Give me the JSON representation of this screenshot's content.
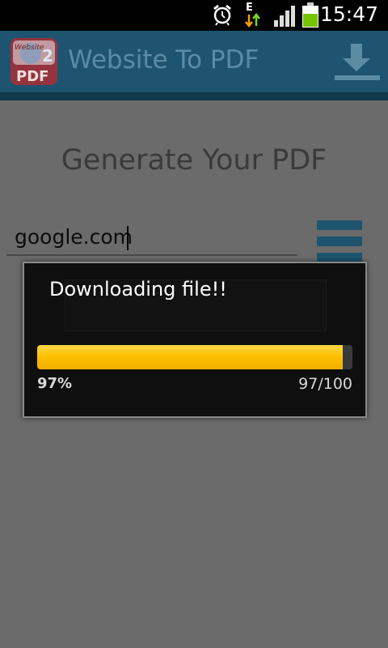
{
  "status_bar": {
    "time": "15:47",
    "network_type": "E",
    "icons": [
      "alarm-icon",
      "data-arrows-icon",
      "signal-icon",
      "battery-icon"
    ]
  },
  "action_bar": {
    "logo_top_text": "Website",
    "logo_number": "2",
    "logo_bottom_text": "PDF",
    "title": "Website To PDF",
    "download_icon": "download-icon",
    "colors": {
      "bar": "#1f5470",
      "title": "#5c8ba4"
    }
  },
  "main": {
    "heading": "Generate Your PDF",
    "url_value": "google.com",
    "menu_icon": "hamburger-menu-icon"
  },
  "dialog": {
    "message": "Downloading file!!",
    "progress_fraction": 0.97,
    "percent_label": "97%",
    "count_label": "97/100",
    "colors": {
      "fill": "#ffc000",
      "background": "#0f0f0f"
    }
  }
}
